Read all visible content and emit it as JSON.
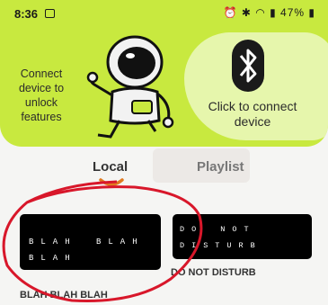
{
  "status_bar": {
    "time": "8:36",
    "battery": "47%"
  },
  "hero": {
    "connect_hint": "Connect device to unlock features",
    "bt_button": "Click to connect device"
  },
  "tabs": [
    {
      "label": "Local"
    },
    {
      "label": "Playlist"
    }
  ],
  "cards": [
    {
      "art_text": "BLAH BLAH BLAH",
      "title": "BLAH BLAH BLAH"
    },
    {
      "art_text": "DO NOT DISTURB",
      "title": "DO NOT DISTURB"
    }
  ],
  "colors": {
    "accent": "#c8e93f",
    "annotation": "#d8172a",
    "tab_indicator": "#e07a20"
  }
}
